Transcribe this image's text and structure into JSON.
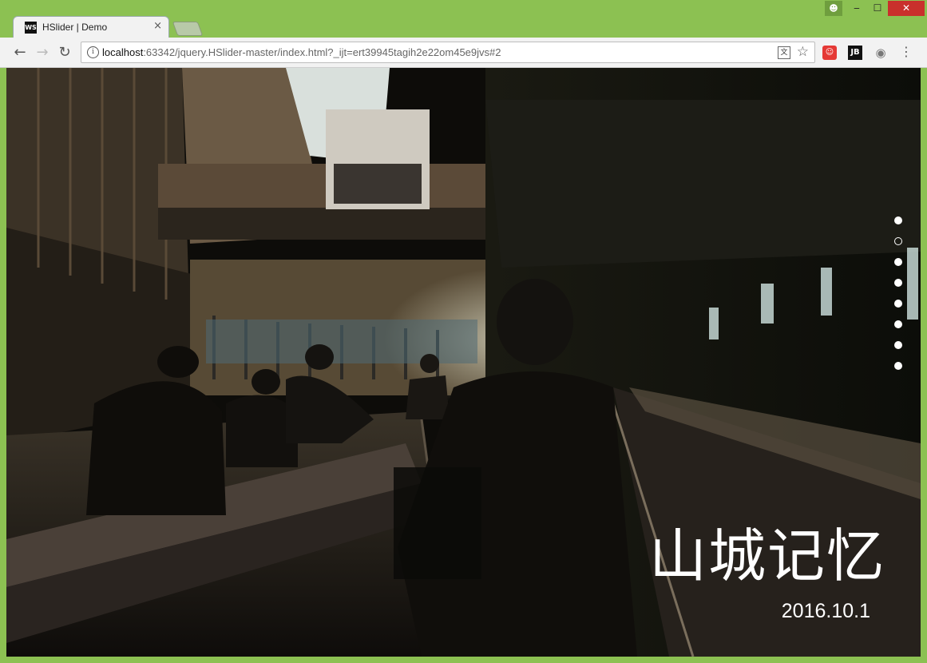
{
  "browser": {
    "tab_title": "HSlider | Demo",
    "tab_favicon_text": "WS",
    "tab_close": "×",
    "url_host": "localhost",
    "url_rest": ":63342/jquery.HSlider-master/index.html?_ijt=ert39945tagih2e22om45e9jvs#2",
    "ext_jb": "JB",
    "window_min": "‒",
    "window_max": "☐",
    "window_close": "✕"
  },
  "slider": {
    "title": "山城记忆",
    "date": "2016.10.1",
    "dots_total": 8,
    "active_index": 1
  },
  "colors": {
    "window_frame": "#8cc152",
    "close_button": "#c9302c"
  }
}
